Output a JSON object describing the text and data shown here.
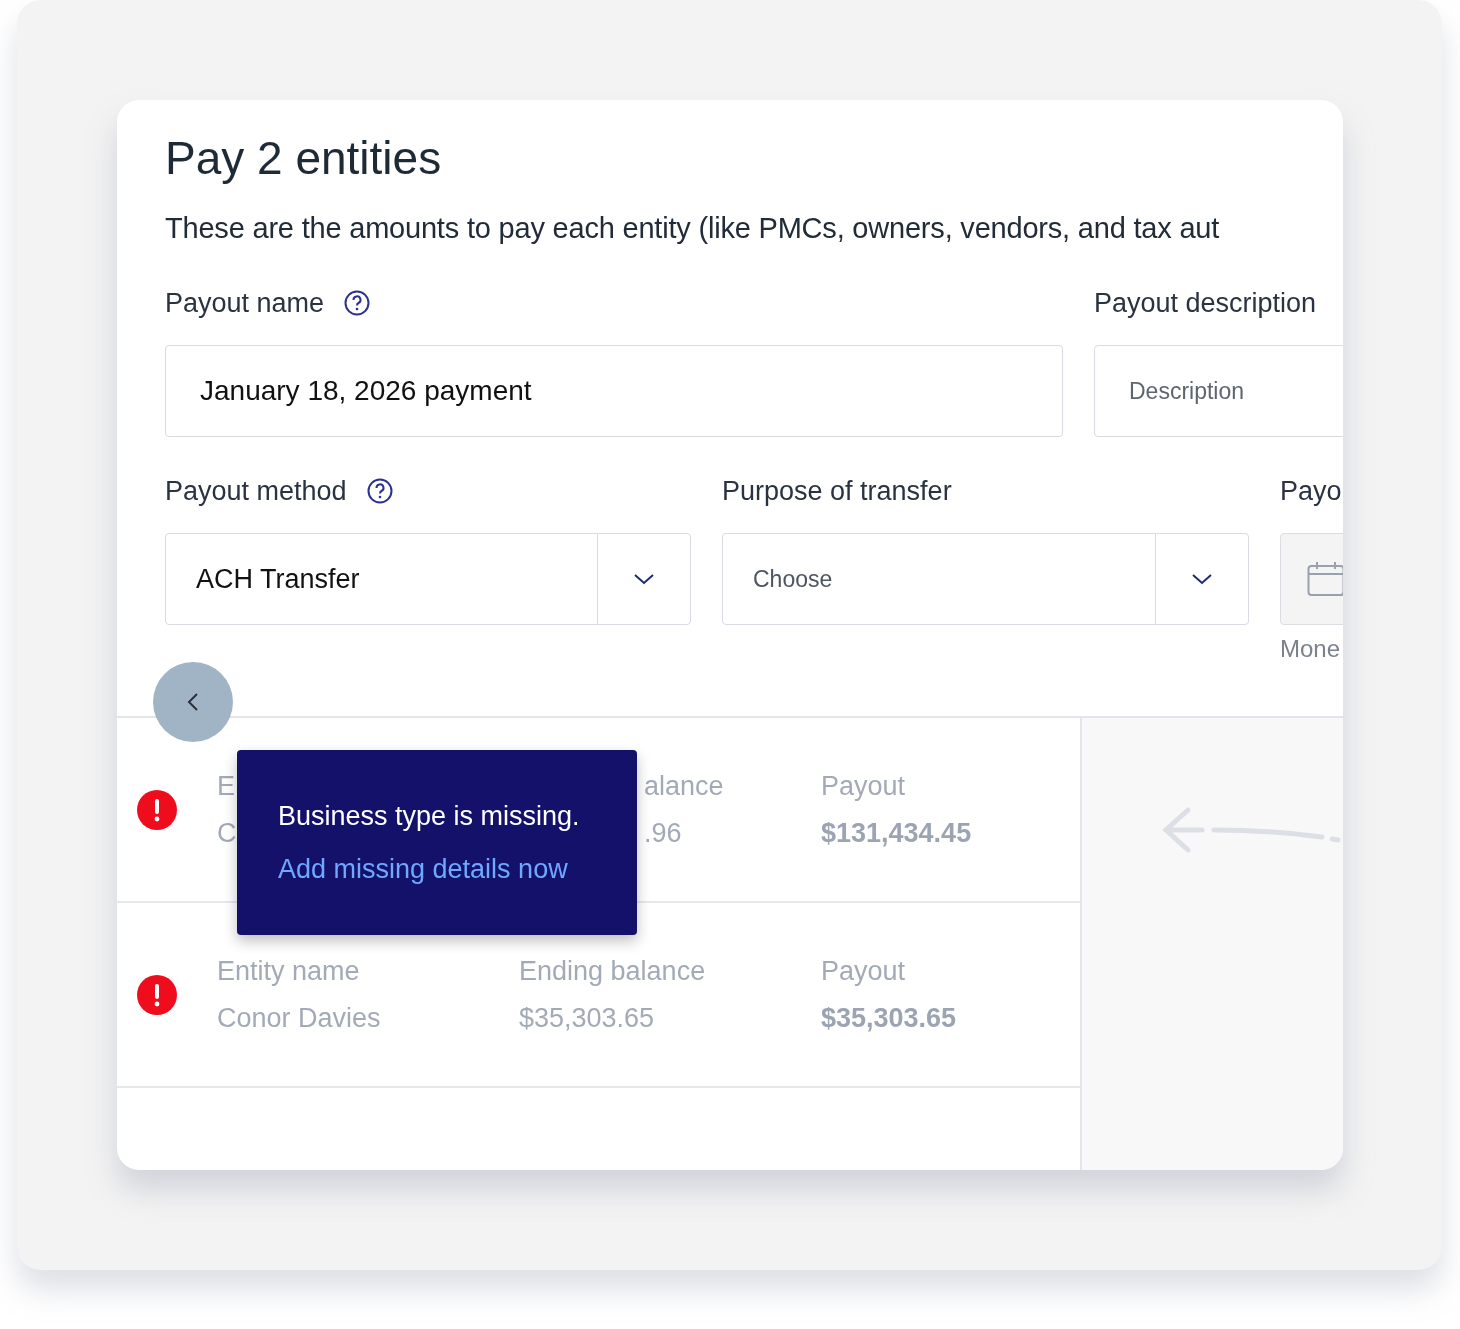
{
  "title": "Pay 2 entities",
  "subtitle": "These are the amounts to pay each entity (like PMCs, owners, vendors, and tax aut",
  "payout_name": {
    "label": "Payout name",
    "help": true,
    "value": "January 18, 2026 payment"
  },
  "payout_description": {
    "label": "Payout description",
    "placeholder": "Description"
  },
  "payout_method": {
    "label": "Payout method",
    "help": true,
    "value": "ACH Transfer"
  },
  "purpose_of_transfer": {
    "label": "Purpose of transfer",
    "placeholder": "Choose"
  },
  "payout_date": {
    "label": "Payo",
    "hint": "Mone"
  },
  "entities": [
    {
      "kind": "covered",
      "alert": true,
      "name_label": "E",
      "name": "C",
      "balance_label": "alance",
      "balance": ".96",
      "payout_label": "Payout",
      "payout": "$131,434.45"
    },
    {
      "kind": "full",
      "alert": true,
      "name_label": "Entity name",
      "name": "Conor Davies",
      "balance_label": "Ending balance",
      "balance": "$35,303.65",
      "payout_label": "Payout",
      "payout": "$35,303.65"
    }
  ],
  "tooltip": {
    "message": "Business type is missing.",
    "link": "Add missing details now"
  }
}
